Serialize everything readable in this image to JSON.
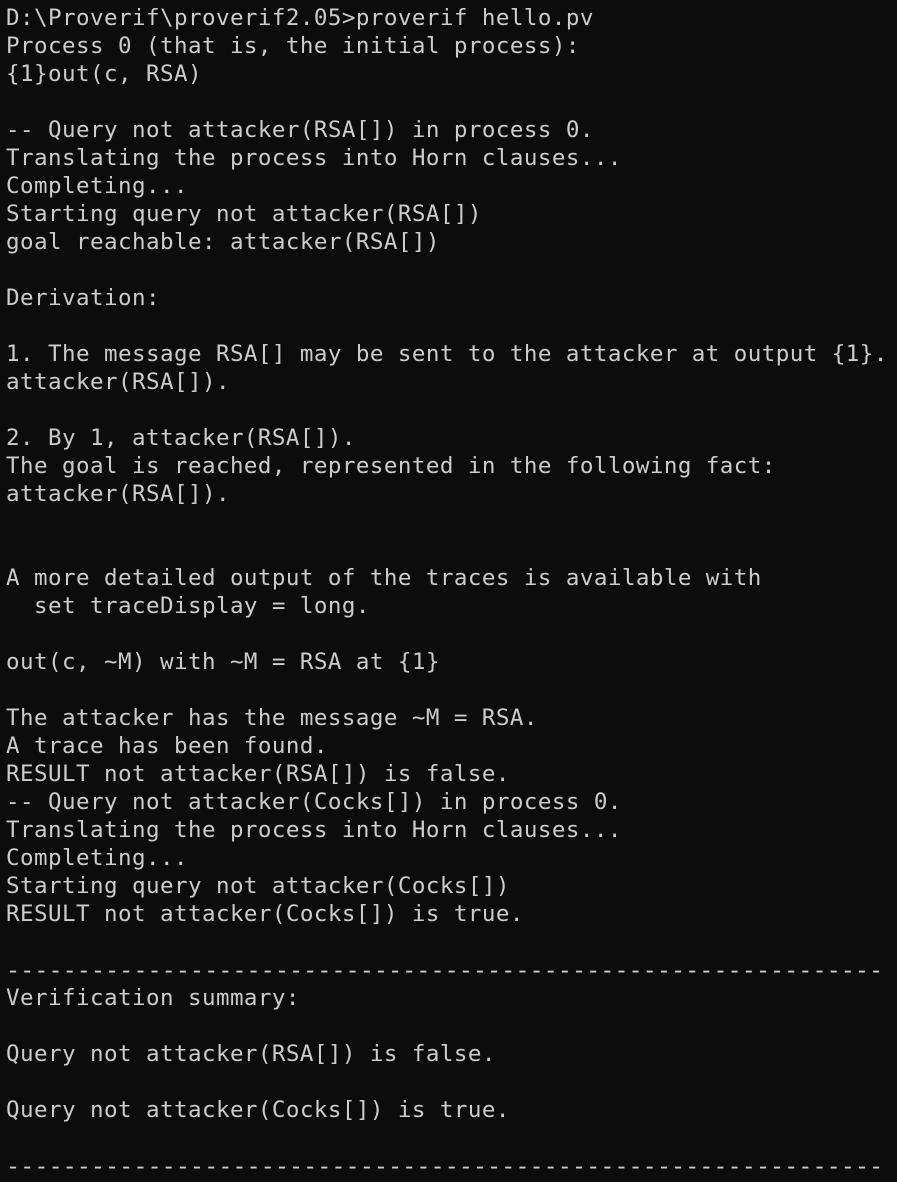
{
  "terminal": {
    "background": "#0c0c0c",
    "foreground": "#cccccc",
    "lines": [
      "D:\\Proverif\\proverif2.05>proverif hello.pv",
      "Process 0 (that is, the initial process):",
      "{1}out(c, RSA)",
      "",
      "-- Query not attacker(RSA[]) in process 0.",
      "Translating the process into Horn clauses...",
      "Completing...",
      "Starting query not attacker(RSA[])",
      "goal reachable: attacker(RSA[])",
      "",
      "Derivation:",
      "",
      "1. The message RSA[] may be sent to the attacker at output {1}.",
      "attacker(RSA[]).",
      "",
      "2. By 1, attacker(RSA[]).",
      "The goal is reached, represented in the following fact:",
      "attacker(RSA[]).",
      "",
      "",
      "A more detailed output of the traces is available with",
      "  set traceDisplay = long.",
      "",
      "out(c, ~M) with ~M = RSA at {1}",
      "",
      "The attacker has the message ~M = RSA.",
      "A trace has been found.",
      "RESULT not attacker(RSA[]) is false.",
      "-- Query not attacker(Cocks[]) in process 0.",
      "Translating the process into Horn clauses...",
      "Completing...",
      "Starting query not attacker(Cocks[])",
      "RESULT not attacker(Cocks[]) is true.",
      "",
      "--------------------------------------------------------------",
      "Verification summary:",
      "",
      "Query not attacker(RSA[]) is false.",
      "",
      "Query not attacker(Cocks[]) is true.",
      "",
      "--------------------------------------------------------------"
    ]
  }
}
